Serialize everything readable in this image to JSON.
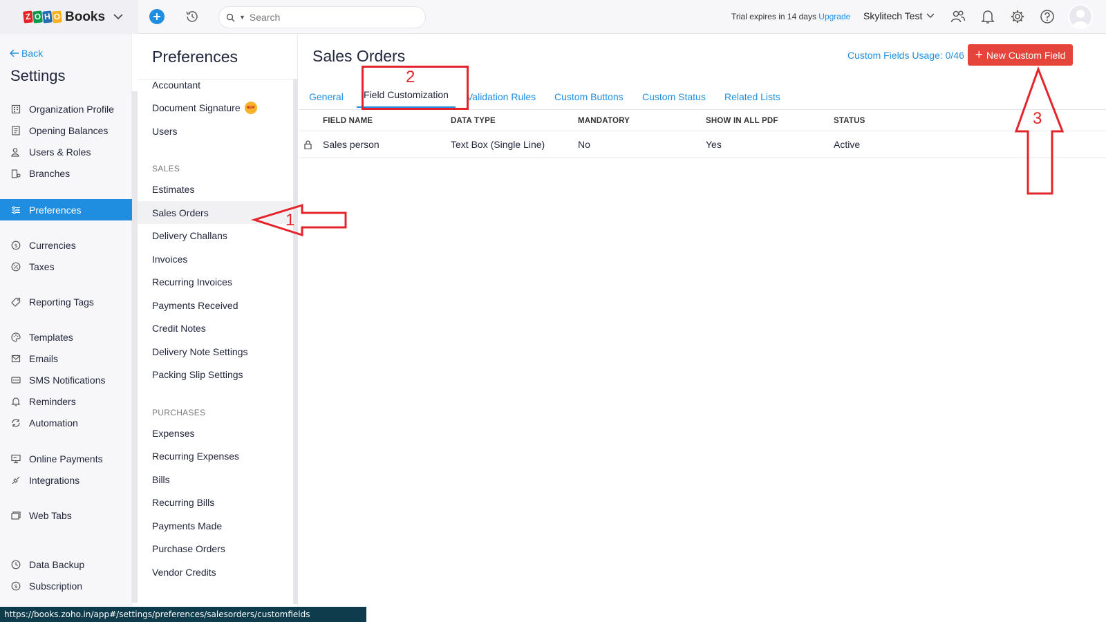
{
  "topbar": {
    "brand_name": "Books",
    "logo_letters": [
      "Z",
      "O",
      "H",
      "O"
    ],
    "logo_colors": [
      "#e42527",
      "#089949",
      "#226db4",
      "#f9b21d"
    ],
    "search_placeholder": "Search",
    "trial_text": "Trial expires in 14 days",
    "upgrade_label": "Upgrade",
    "org_name": "Skylitech Test"
  },
  "settings_nav": {
    "back_label": "Back",
    "title": "Settings",
    "items": [
      {
        "label": "Organization Profile",
        "icon": "building-icon"
      },
      {
        "label": "Opening Balances",
        "icon": "ledger-icon"
      },
      {
        "label": "Users & Roles",
        "icon": "users-icon"
      },
      {
        "label": "Branches",
        "icon": "branch-icon"
      },
      {
        "label": "Preferences",
        "icon": "sliders-icon",
        "active": true
      },
      {
        "label": "Currencies",
        "icon": "currency-icon"
      },
      {
        "label": "Taxes",
        "icon": "percent-icon"
      },
      {
        "label": "Reporting Tags",
        "icon": "tag-icon"
      },
      {
        "label": "Templates",
        "icon": "palette-icon"
      },
      {
        "label": "Emails",
        "icon": "email-icon"
      },
      {
        "label": "SMS Notifications",
        "icon": "sms-icon"
      },
      {
        "label": "Reminders",
        "icon": "bell-icon"
      },
      {
        "label": "Automation",
        "icon": "automation-icon"
      },
      {
        "label": "Online Payments",
        "icon": "payments-icon"
      },
      {
        "label": "Integrations",
        "icon": "integrations-icon"
      },
      {
        "label": "Web Tabs",
        "icon": "tabs-icon"
      },
      {
        "label": "Data Backup",
        "icon": "backup-icon"
      },
      {
        "label": "Subscription",
        "icon": "subscription-icon"
      }
    ]
  },
  "pref_nav": {
    "title": "Preferences",
    "top_items": [
      "Accountant",
      "Document Signature",
      "Users"
    ],
    "new_badge": "NEW",
    "sales_heading": "SALES",
    "sales_items": [
      "Estimates",
      "Sales Orders",
      "Delivery Challans",
      "Invoices",
      "Recurring Invoices",
      "Payments Received",
      "Credit Notes",
      "Delivery Note Settings",
      "Packing Slip Settings"
    ],
    "purchases_heading": "PURCHASES",
    "purchase_items": [
      "Expenses",
      "Recurring Expenses",
      "Bills",
      "Recurring Bills",
      "Payments Made",
      "Purchase Orders",
      "Vendor Credits"
    ],
    "selected": "Sales Orders"
  },
  "main": {
    "title": "Sales Orders",
    "usage_text": "Custom Fields Usage: 0/46",
    "new_button": "New Custom Field",
    "tabs": [
      "General",
      "Field Customization",
      "Validation Rules",
      "Custom Buttons",
      "Custom Status",
      "Related Lists"
    ],
    "active_tab": "Field Customization",
    "columns": [
      "FIELD NAME",
      "DATA TYPE",
      "MANDATORY",
      "SHOW IN ALL PDF",
      "STATUS"
    ],
    "rows": [
      {
        "field_name": "Sales person",
        "data_type": "Text Box (Single Line)",
        "mandatory": "No",
        "show_in_pdf": "Yes",
        "status": "Active"
      }
    ]
  },
  "annotations": [
    "1",
    "2",
    "3"
  ],
  "status_url": "https://books.zoho.in/app#/settings/preferences/salesorders/customfields",
  "colors": {
    "accent": "#1f8ee0",
    "danger": "#e5443b",
    "annotation": "#e3242b",
    "status_bar": "#0f3c4c"
  }
}
